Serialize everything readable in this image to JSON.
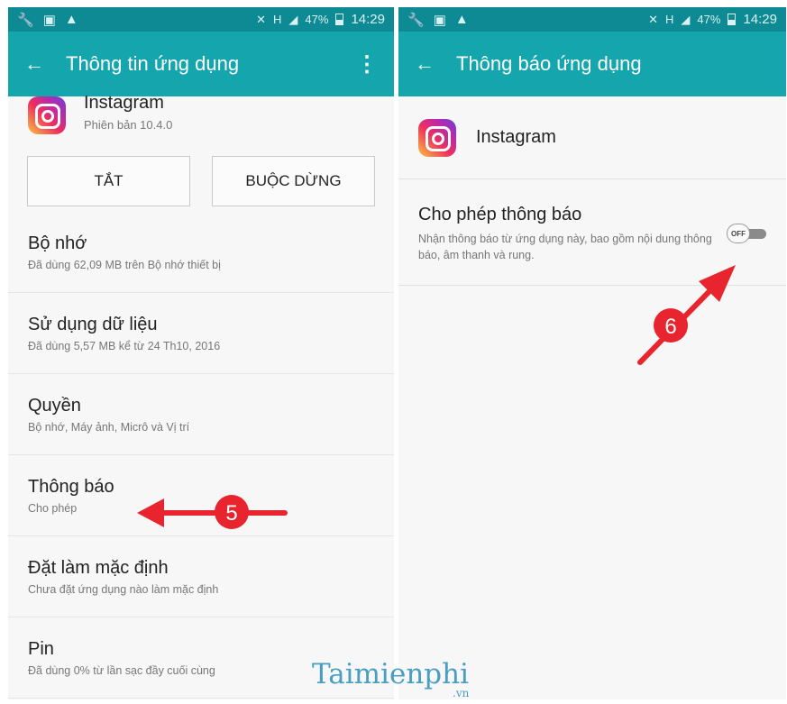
{
  "left": {
    "status": {
      "signal_h": "H",
      "battery": "47%",
      "time": "14:29"
    },
    "appbar": {
      "title": "Thông tin ứng dụng"
    },
    "app": {
      "name": "Instagram",
      "version": "Phiên bản 10.4.0"
    },
    "buttons": {
      "disable": "TẮT",
      "force_stop": "BUỘC DỪNG"
    },
    "items": [
      {
        "title": "Bộ nhớ",
        "sub": "Đã dùng 62,09 MB trên Bộ nhớ thiết bị"
      },
      {
        "title": "Sử dụng dữ liệu",
        "sub": "Đã dùng 5,57 MB kể từ 24 Th10, 2016"
      },
      {
        "title": "Quyền",
        "sub": "Bộ nhớ, Máy ảnh, Micrô và Vị trí"
      },
      {
        "title": "Thông báo",
        "sub": "Cho phép"
      },
      {
        "title": "Đặt làm mặc định",
        "sub": "Chưa đặt ứng dụng nào làm mặc định"
      },
      {
        "title": "Pin",
        "sub": "Đã dùng 0% từ lần sạc đầy cuối cùng"
      }
    ]
  },
  "right": {
    "status": {
      "signal_h": "H",
      "battery": "47%",
      "time": "14:29"
    },
    "appbar": {
      "title": "Thông báo ứng dụng"
    },
    "app": {
      "name": "Instagram"
    },
    "setting": {
      "title": "Cho phép thông báo",
      "sub": "Nhận thông báo từ ứng dụng này, bao gồm nội dung thông báo, âm thanh và rung.",
      "toggle_label": "OFF"
    }
  },
  "annotations": {
    "step5": "5",
    "step6": "6",
    "color": "#e8252e"
  },
  "watermark": {
    "brand": "Taimienphi",
    "tld": ".vn"
  },
  "colors": {
    "statusbar": "#0e8a94",
    "appbar": "#14a5ad"
  }
}
